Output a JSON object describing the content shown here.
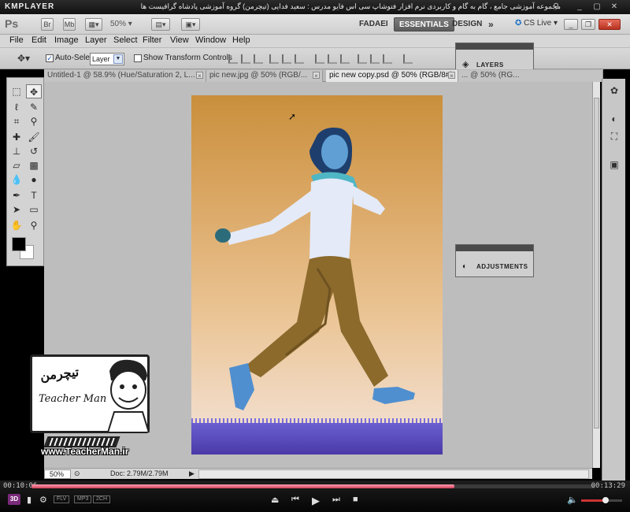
{
  "player": {
    "logo": "KMPLAYER",
    "caption": "مجموعه آموزشی جامع ، گام به گام و کاربردی نرم افزار فتوشاپ سی اس فایو   مدرس : سعید فدایی (تیچرمن) گروه آموزشی پادشاه گرافیست ها",
    "time_elapsed": "00:10:06",
    "time_total": "00:13:29",
    "progress": 0.75,
    "volume": 0.6,
    "badges": [
      "FLV",
      "MP3",
      "2CH"
    ],
    "label_3d": "3D"
  },
  "appbar": {
    "logo": "Ps",
    "bridge_label": "Br",
    "minibridge_label": "Mb",
    "zoom": "50%",
    "workspaces": [
      "FADAEI",
      "ESSENTIALS",
      "DESIGN"
    ],
    "active_workspace": "ESSENTIALS",
    "more": "»",
    "cs_live": "CS Live"
  },
  "menu": [
    "File",
    "Edit",
    "Image",
    "Layer",
    "Select",
    "Filter",
    "View",
    "Window",
    "Help"
  ],
  "options": {
    "auto_select_label": "Auto-Select:",
    "auto_select_checked": true,
    "auto_select_value": "Layer",
    "show_transform_label": "Show Transform Controls",
    "show_transform_checked": false
  },
  "panels": {
    "layers": "LAYERS",
    "adjustments": "ADJUSTMENTS"
  },
  "tabs": [
    {
      "label": "Untitled-1 @ 58.9% (Hue/Saturation 2, L...",
      "active": false
    },
    {
      "label": "pic new.jpg @ 50% (RGB/...",
      "active": false
    },
    {
      "label": "pic new copy.psd @ 50% (RGB/8#)",
      "active": true
    },
    {
      "label": "... @ 50% (RG...",
      "active": false
    }
  ],
  "status": {
    "zoom": "50%",
    "doc_info": "Doc: 2.79M/2.79M"
  },
  "watermark": {
    "brand_fa": "تیچرمن",
    "brand_en": "Teacher Man",
    "url": "www.TeacherMan.ir"
  },
  "colors": {
    "ps_close": "#b8321f",
    "seek_fill": "#d0405a",
    "canvas_top": "#c98f3c",
    "grass": "#5a4cc0"
  }
}
